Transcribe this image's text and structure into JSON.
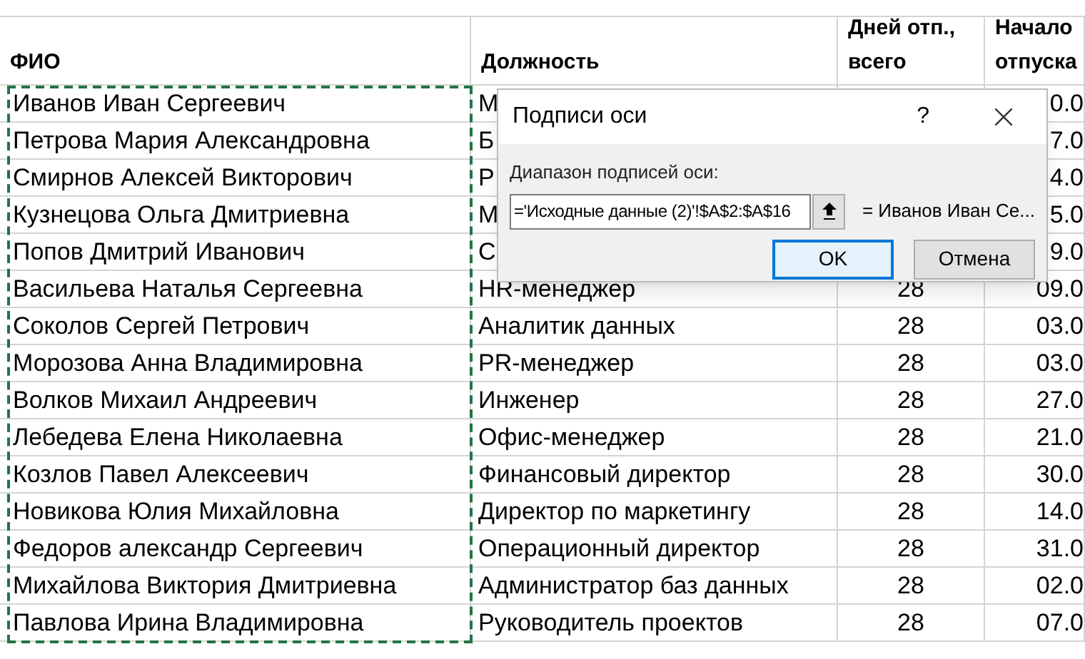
{
  "table": {
    "columns": [
      "ФИО",
      "Должность",
      "Дней отп., всего",
      "Начало отпуска"
    ],
    "rows": [
      {
        "cells": [
          "Иванов Иван Сергеевич",
          "М",
          "",
          "0.0"
        ]
      },
      {
        "cells": [
          "Петрова Мария Александровна",
          "Б",
          "",
          "7.0"
        ]
      },
      {
        "cells": [
          "Смирнов Алексей Викторович",
          "Р",
          "",
          "4.0"
        ]
      },
      {
        "cells": [
          "Кузнецова Ольга Дмитриевна",
          "М",
          "",
          "5.0"
        ]
      },
      {
        "cells": [
          "Попов Дмитрий Иванович",
          "С",
          "",
          "9.0"
        ]
      },
      {
        "cells": [
          "Васильева Наталья Сергеевна",
          "HR-менеджер",
          "28",
          "09.0"
        ]
      },
      {
        "cells": [
          "Соколов Сергей Петрович",
          "Аналитик данных",
          "28",
          "03.0"
        ]
      },
      {
        "cells": [
          "Морозова Анна Владимировна",
          "PR-менеджер",
          "28",
          "03.0"
        ]
      },
      {
        "cells": [
          "Волков Михаил Андреевич",
          "Инженер",
          "28",
          "27.0"
        ]
      },
      {
        "cells": [
          "Лебедева Елена Николаевна",
          "Офис-менеджер",
          "28",
          "21.0"
        ]
      },
      {
        "cells": [
          "Козлов Павел Алексеевич",
          "Финансовый директор",
          "28",
          "30.0"
        ]
      },
      {
        "cells": [
          "Новикова Юлия Михайловна",
          "Директор по маркетингу",
          "28",
          "14.0"
        ]
      },
      {
        "cells": [
          "Федоров александр Сергеевич",
          "Операционный директор",
          "28",
          "31.0"
        ]
      },
      {
        "cells": [
          "Михайлова Виктория Дмитриевна",
          "Администратор баз данных",
          "28",
          "02.0"
        ]
      },
      {
        "cells": [
          "Павлова Ирина Владимировна",
          "Руководитель проектов",
          "28",
          "07.0"
        ]
      }
    ]
  },
  "dialog": {
    "title": "Подписи оси",
    "help": "?",
    "label": "Диапазон подписей оси:",
    "value": "='Исходные данные (2)'!$A$2:$A$16",
    "preview": "= Иванов Иван Се...",
    "buttons": [
      {
        "label": "OK",
        "selected": true
      },
      {
        "label": "Отмена",
        "selected": false
      }
    ]
  }
}
